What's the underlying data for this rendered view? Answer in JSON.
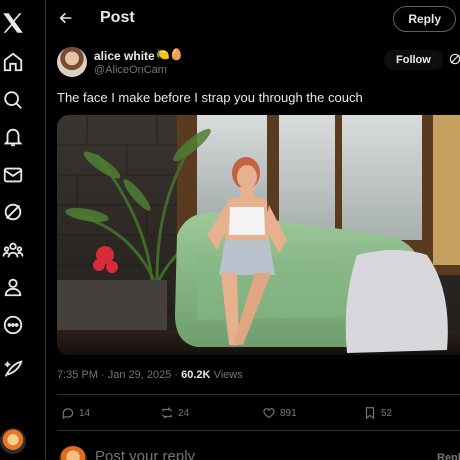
{
  "sidebar": {
    "items": [
      {
        "name": "x-logo-icon"
      },
      {
        "name": "home-icon"
      },
      {
        "name": "explore-icon"
      },
      {
        "name": "notifications-icon"
      },
      {
        "name": "messages-icon"
      },
      {
        "name": "grok-icon"
      },
      {
        "name": "communities-icon"
      },
      {
        "name": "profile-icon"
      },
      {
        "name": "more-icon"
      },
      {
        "name": "post-compose-icon"
      }
    ]
  },
  "header": {
    "title": "Post",
    "reply_label": "Reply"
  },
  "post": {
    "author_name": "alice white",
    "author_emoji": "🍋🥚",
    "author_handle": "@AliceOnCam",
    "follow_label": "Follow",
    "text": "The face I make before I strap you through the couch",
    "timestamp": "7:35 PM · Jan 29, 2025",
    "separator": " · ",
    "views_count": "60.2K",
    "views_label": "Views"
  },
  "actions": {
    "replies": "14",
    "reposts": "24",
    "likes": "891",
    "bookmarks": "52"
  },
  "composer": {
    "placeholder": "Post your reply",
    "reply_label": "Reply"
  },
  "colors": {
    "background": "#000000",
    "text": "#e7e9ea",
    "muted": "#71767b",
    "border": "#2f3336"
  }
}
